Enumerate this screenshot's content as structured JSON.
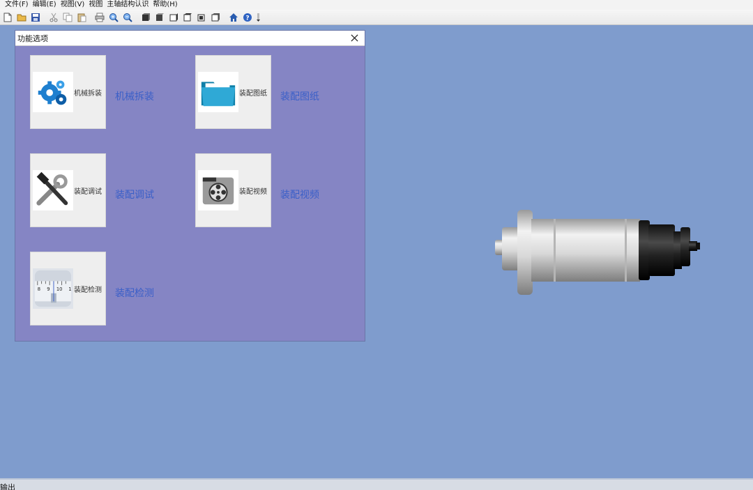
{
  "menu": [
    "文件(F)",
    "编辑(E)",
    "视图(V)",
    "视图",
    "主轴结构认识",
    "帮助(H)"
  ],
  "toolbar": {
    "icons": [
      "new-file-icon",
      "open-folder-icon",
      "save-icon",
      "cut-icon",
      "copy-icon",
      "paste-icon",
      "print-icon",
      "zoom-in-icon",
      "zoom-out-icon",
      "view-front-icon",
      "view-back-icon",
      "view-left-icon",
      "view-right-icon",
      "view-top-icon",
      "view-bottom-icon",
      "home-icon",
      "help-icon"
    ]
  },
  "dialog": {
    "title": "功能选项",
    "items": [
      {
        "caption": "机械拆装",
        "link": "机械拆装",
        "icon": "gears-icon"
      },
      {
        "caption": "装配图纸",
        "link": "装配图纸",
        "icon": "folder-icon"
      },
      {
        "caption": "装配调试",
        "link": "装配调试",
        "icon": "tools-icon"
      },
      {
        "caption": "装配视频",
        "link": "装配视频",
        "icon": "film-reel-icon"
      },
      {
        "caption": "装配检测",
        "link": "装配检测",
        "icon": "ruler-gauge-icon"
      }
    ]
  },
  "gauge_ticks": [
    "8",
    "9",
    "10",
    "1"
  ],
  "output": {
    "label": "输出"
  },
  "colors": {
    "workspace": "#7f9ccd",
    "dialog_bg": "#8585c4",
    "link": "#3a5fc8"
  }
}
